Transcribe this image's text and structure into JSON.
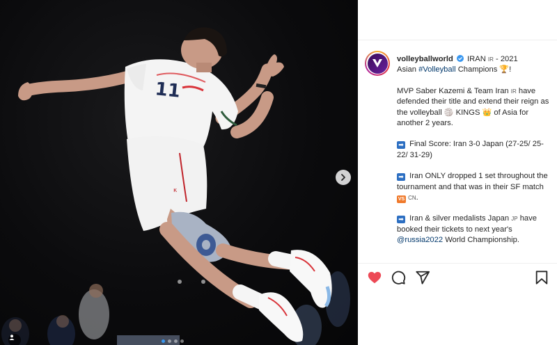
{
  "post": {
    "username": "volleyballworld",
    "caption_line1_rest": "IRAN",
    "flag_ir": "IR",
    "caption_year": "- 2021",
    "caption_line2_pre": "Asian",
    "hashtag": "#Volleyball",
    "caption_line2_post": "Champions",
    "trophy": "🏆",
    "exclaim": "!",
    "p1_a": "MVP Saber Kazemi & Team Iran",
    "p1_flag": "IR",
    "p1_b": "have defended their title and extend their reign as the volleyball",
    "volleyball_emoji": "🏐",
    "p1_c": "KINGS",
    "crown_emoji": "👑",
    "p1_d": "of Asia for another 2 years.",
    "arrow": "➡",
    "p2": "Final Score: Iran 3-0 Japan (27-25/ 25-22/ 31-29)",
    "p3_a": "Iran ONLY dropped 1 set throughout the tournament and that was in their SF match",
    "vs": "VS",
    "p3_flag": "CN",
    "p3_end": ".",
    "p4_a": "Iran & silver medalists Japan",
    "p4_flag": "JP",
    "p4_b": "have booked their tickets to next year's",
    "mention": "@russia2022",
    "p4_c": "World Championship."
  },
  "actions": {
    "like_icon": "heart-icon",
    "comment_icon": "comment-icon",
    "share_icon": "share-icon",
    "save_icon": "bookmark-icon"
  },
  "colors": {
    "like_red": "#ed4956",
    "link_blue": "#00376b",
    "verified_blue": "#3897f0"
  }
}
